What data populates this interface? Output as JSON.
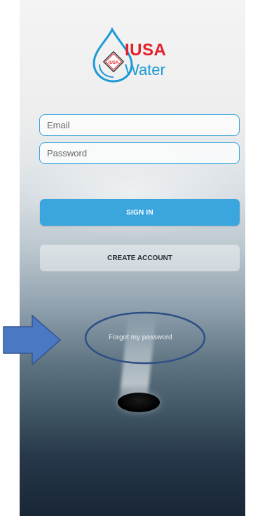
{
  "logo": {
    "brand_top": "IUSA",
    "brand_bottom": "Water",
    "badge_text": "IUSA"
  },
  "form": {
    "email_placeholder": "Email",
    "password_placeholder": "Password"
  },
  "actions": {
    "signin_label": "SIGN IN",
    "create_account_label": "CREATE ACCOUNT",
    "forgot_label": "Forgot my password"
  },
  "colors": {
    "accent_blue": "#3aa6dd",
    "brand_red": "#e2202a",
    "annotation_arrow": "#4a78c2"
  }
}
